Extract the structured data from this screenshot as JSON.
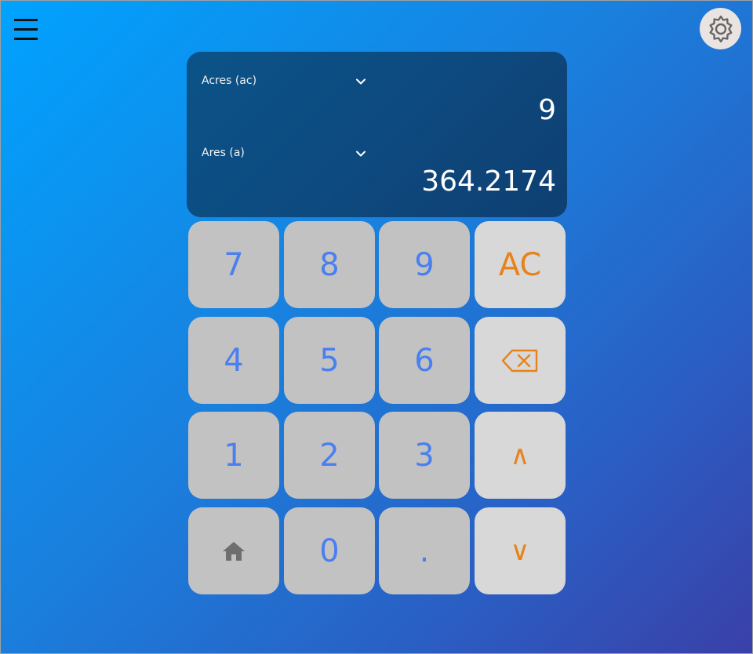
{
  "header": {
    "menu_icon": "hamburger-menu-icon",
    "settings_icon": "gear-icon"
  },
  "converter": {
    "from_unit": "Acres (ac)",
    "to_unit": "Ares (a)",
    "input_value": "9",
    "output_value": "364.2174"
  },
  "keypad": {
    "row1": [
      "7",
      "8",
      "9",
      "AC"
    ],
    "row2": [
      "4",
      "5",
      "6"
    ],
    "backspace_icon": "backspace-icon",
    "row3": [
      "1",
      "2",
      "3",
      "∧"
    ],
    "home_icon": "home-icon",
    "row4": [
      "0",
      ".",
      "∨"
    ]
  },
  "colors": {
    "digit": "#4a7ff0",
    "operator": "#e8821a",
    "display_bg": "#0d4a7f"
  }
}
